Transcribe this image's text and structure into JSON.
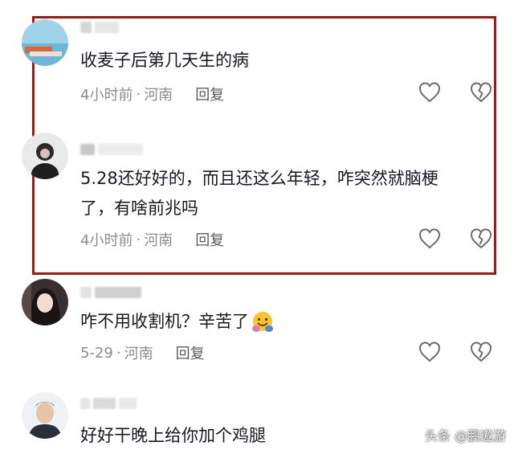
{
  "comments": [
    {
      "text": "收麦子后第几天生的病",
      "time": "4小时前",
      "sep": "·",
      "location": "河南",
      "reply_label": "回复"
    },
    {
      "text_line1": "5.28还好好的，而且还这么年轻，咋突然就脑梗",
      "text_line2": "了，有啥前兆吗",
      "time": "4小时前",
      "sep": "·",
      "location": "河南",
      "reply_label": "回复"
    },
    {
      "text": "咋不用收割机？辛苦了",
      "emoji": "hug-emoji",
      "time": "5-29",
      "sep": "·",
      "location": "河南",
      "reply_label": "回复"
    },
    {
      "text": "好好干晚上给你加个鸡腿"
    }
  ],
  "icons": {
    "like": "heart-icon",
    "dislike": "broken-heart-icon"
  },
  "highlight_color": "#a21818",
  "watermark": "头条 @鹏遨游"
}
